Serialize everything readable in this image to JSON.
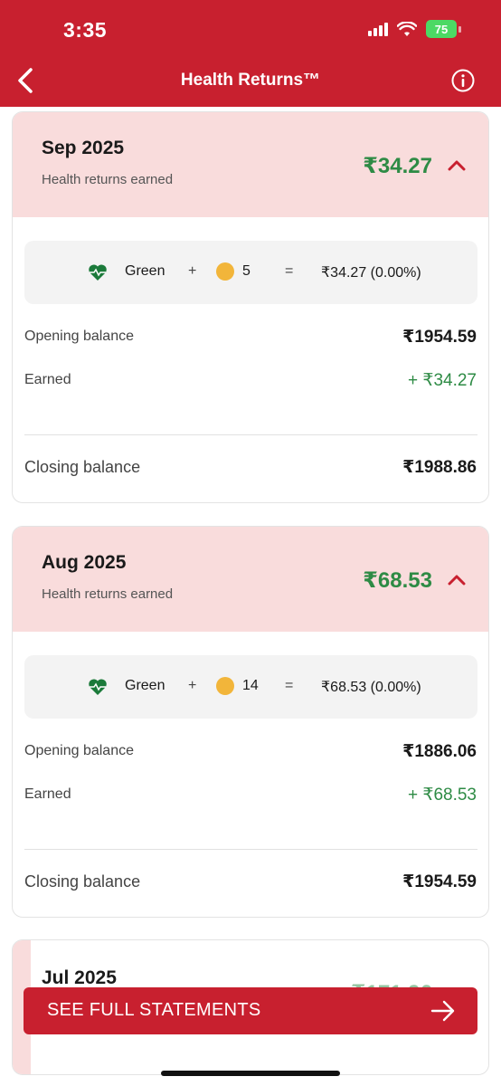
{
  "status_bar": {
    "time": "3:35",
    "battery": "75"
  },
  "nav": {
    "title": "Health Returns™"
  },
  "cards": [
    {
      "month": "Sep 2025",
      "subtitle": "Health returns earned",
      "amount": "₹34.27",
      "formula": {
        "tier": "Green",
        "plus": "+",
        "coins": "5",
        "equals": "=",
        "result": "₹34.27 (0.00%)"
      },
      "opening_label": "Opening balance",
      "opening_value": "₹1954.59",
      "earned_label": "Earned",
      "earned_value": "+ ₹34.27",
      "closing_label": "Closing balance",
      "closing_value": "₹1988.86"
    },
    {
      "month": "Aug 2025",
      "subtitle": "Health returns earned",
      "amount": "₹68.53",
      "formula": {
        "tier": "Green",
        "plus": "+",
        "coins": "14",
        "equals": "=",
        "result": "₹68.53 (0.00%)"
      },
      "opening_label": "Opening balance",
      "opening_value": "₹1886.06",
      "earned_label": "Earned",
      "earned_value": "+ ₹68.53",
      "closing_label": "Closing balance",
      "closing_value": "₹1954.59"
    },
    {
      "month": "Jul 2025",
      "amount": "₹171.96"
    }
  ],
  "cta": {
    "label": "SEE FULL STATEMENTS"
  },
  "colors": {
    "brand_red": "#c8202f",
    "header_pink": "#f9dcdc",
    "earned_green": "#2e8b45"
  }
}
